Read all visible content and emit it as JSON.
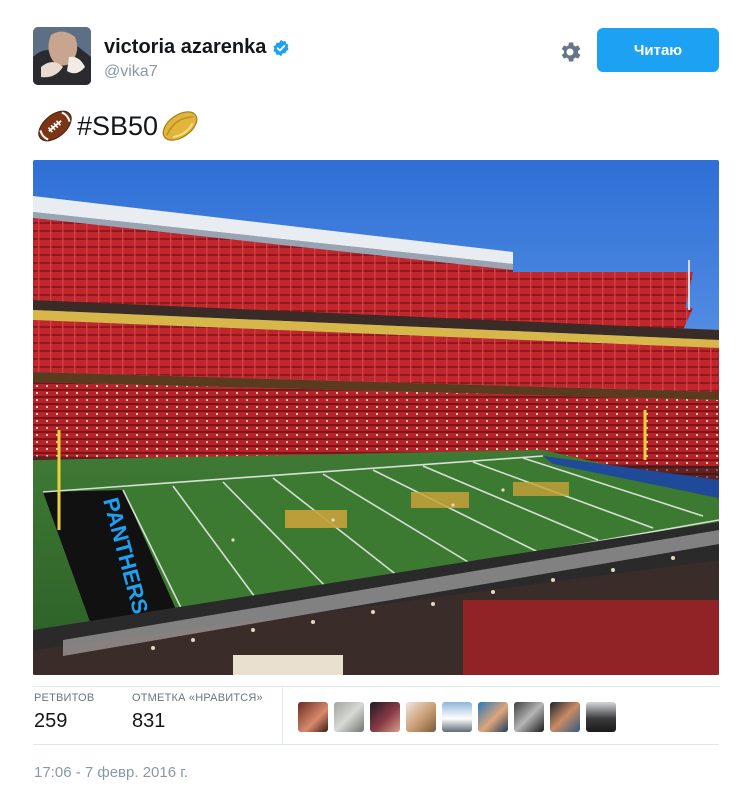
{
  "user": {
    "name": "victoria azarenka",
    "handle": "@vika7",
    "verified_icon": "verified-badge-icon",
    "avatar_icon": "user-avatar"
  },
  "actions": {
    "gear_icon": "gear-icon",
    "follow_label": "Читаю",
    "follow_color": "#1da1f2"
  },
  "tweet": {
    "text": "#SB50",
    "emoji_left": "american-football-icon",
    "emoji_right": "rugby-football-icon"
  },
  "media": {
    "icon": "stadium-photo"
  },
  "stats": {
    "retweets_label": "РЕТВИТОВ",
    "retweets_value": "259",
    "likes_label": "ОТМЕТКА «НРАВИТСЯ»",
    "likes_value": "831"
  },
  "likers": [
    "liker-avatar-1",
    "liker-avatar-2",
    "liker-avatar-3",
    "liker-avatar-4",
    "liker-avatar-5",
    "liker-avatar-6",
    "liker-avatar-7",
    "liker-avatar-8",
    "liker-avatar-9"
  ],
  "timestamp": "17:06 - 7 февр. 2016 г."
}
